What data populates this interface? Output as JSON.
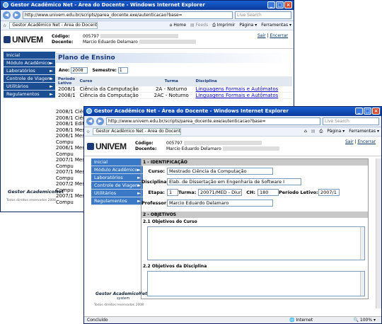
{
  "w1": {
    "title": "Gestor Acadêmico Net - Área do Docente - Windows Internet Explorer",
    "url": "http://www.univem.edu.br/scripts/parea_docente.exe/autenticacao?base=",
    "search": "Live Search",
    "tab": "Gestor Acadêmico Net - Área do Docente",
    "home": "Home",
    "feeds": "Feeds",
    "print": "Imprimir",
    "page": "Página",
    "tools": "Ferramentas",
    "logo": "UNIVEM",
    "codigo_lbl": "Código:",
    "codigo": "005797",
    "docente_lbl": "Docente:",
    "docente": "Marcio Eduardo Delamaro",
    "sair": "Sair",
    "encerrar": "Encerrar",
    "menu": [
      "Inicial",
      "Módulo Acadêmico",
      "Laboratórios",
      "Controle de Viagem",
      "Utilitários",
      "Regulamentos"
    ],
    "page_title": "Plano de Ensino",
    "ano_lbl": "Ano:",
    "ano": "2008",
    "sem_lbl": "Semestre:",
    "sem": "1",
    "cols": [
      "Período Letivo",
      "Curso",
      "Turma",
      "Disciplina"
    ],
    "rows": [
      [
        "2008/1",
        "Ciência da Computação",
        "2A - Noturno",
        "Linguagens Formais e Autômatos"
      ],
      [
        "2008/1",
        "Ciência da Computação",
        "2AC - Noturno",
        "Linguagens Formais e Autômatos"
      ]
    ],
    "behind": [
      "2008/1 Ciênc",
      "2008/1 Ciênc",
      "2008/1 Editor",
      "2008/1 Mestr",
      "2006/1 Mestr",
      "Compu",
      "2006/1 Mestr",
      "Compu",
      "2007/1 Mestr",
      "Compu",
      "2007/1 Mestr",
      "Compu",
      "2007/2 Mestr",
      "Compu",
      "2007/1 Mestr",
      "Compu"
    ],
    "gsa": "Gestor AcademicoNet",
    "rights": "Todos direitos reservados 2008"
  },
  "w2": {
    "title": "Gestor Acadêmico Net - Área do Docente - Windows Internet Explorer",
    "url": "http://www.univem.edu.br/scripts/parea_docente.exe/autenticacao?base=",
    "search": "Live Search",
    "tab": "Gestor Acadêmico Net - Área do Docente",
    "page": "Página",
    "tools": "Ferramentas",
    "logo": "UNIVEM",
    "codigo_lbl": "Código:",
    "codigo": "005797",
    "docente_lbl": "Docente:",
    "docente": "Marcio Eduardo Delamaro",
    "sair": "Sair",
    "encerrar": "Encerrar",
    "menu": [
      "Inicial",
      "Módulo Acadêmico",
      "Laboratórios",
      "Controle de Viagem",
      "Utilitários",
      "Regulamentos"
    ],
    "sec1": "1 - IDENTIFICAÇÃO",
    "curso_lbl": "Curso:",
    "curso": "Mestrado Ciência da Computação",
    "disc_lbl": "Disciplina:",
    "disc": "Elab. de Dissertação em Engenharia de Software I",
    "etapa_lbl": "Etapa:",
    "etapa": "1",
    "turma_lbl": "Turma:",
    "turma": "20071/MED - Diurno",
    "ch_lbl": "CH:",
    "ch": "180",
    "periodo_lbl": "Período Letivo:",
    "periodo": "2007/1",
    "prof_lbl": "Professor:",
    "prof": "Marcio Eduardo Delamaro",
    "sec2": "2 - OBJETIVOS",
    "obj1": "2.1 Objetivos do Curso",
    "obj2": "2.2 Objetivos da Disciplina",
    "gsa": "Gestor AcademicoNet",
    "gsa2": "system",
    "rights": "Todos direitos reservados 2008",
    "status": "Concluído",
    "zone": "Internet",
    "zoom": "100%"
  }
}
